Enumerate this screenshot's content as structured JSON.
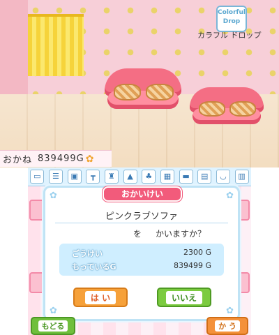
{
  "top_screen": {
    "logo_text_line1": "Colorful",
    "logo_text_line2": "Drop",
    "logo_subtitle": "カラフル ドロップ",
    "money_label": "おかね",
    "money_value": "839499G",
    "money_icon": "paw-icon"
  },
  "toolbar": {
    "icons": [
      "bed-icon",
      "drawer-icon",
      "box-icon",
      "table-icon",
      "chair-icon",
      "lamp-icon",
      "plant-icon",
      "window-icon",
      "rug-icon",
      "shelf-icon",
      "bath-icon",
      "grid-icon"
    ]
  },
  "dialog": {
    "title": "おかいけい",
    "item_name": "ピンクラブソファ",
    "question_particle": "を",
    "question_rest": "かいますか？",
    "total_label": "ごうけい",
    "total_value": "2300 G",
    "owned_label": "もっているG",
    "owned_value": "839499 G",
    "yes_label": "は い",
    "no_label": "いいえ"
  },
  "bottom_buttons": {
    "back_label": "もどる",
    "buy_label": "か う"
  },
  "colors": {
    "accent_pink": "#f25b7b",
    "yes_orange": "#f6a13a",
    "no_green": "#7ccb40"
  }
}
